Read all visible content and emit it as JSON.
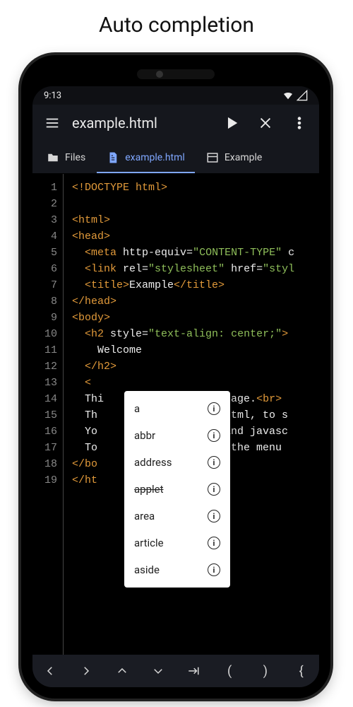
{
  "page_heading": "Auto completion",
  "status": {
    "time": "9:13"
  },
  "appbar": {
    "title": "example.html"
  },
  "tabs": [
    {
      "id": "files",
      "label": "Files",
      "active": false
    },
    {
      "id": "example",
      "label": "example.html",
      "active": true
    },
    {
      "id": "preview",
      "label": "Example",
      "active": false
    }
  ],
  "line_count": 19,
  "code_segments": [
    [
      {
        "c": "t-doctype",
        "t": "<!DOCTYPE html>"
      }
    ],
    [],
    [
      {
        "c": "t-tag",
        "t": "<html>"
      }
    ],
    [
      {
        "c": "t-tag",
        "t": "<head>"
      }
    ],
    [
      {
        "c": "",
        "t": "  "
      },
      {
        "c": "t-tag",
        "t": "<meta "
      },
      {
        "c": "t-attr",
        "t": "http-equiv="
      },
      {
        "c": "t-val",
        "t": "\"CONTENT-TYPE\""
      },
      {
        "c": "t-attr",
        "t": " c"
      }
    ],
    [
      {
        "c": "",
        "t": "  "
      },
      {
        "c": "t-tag",
        "t": "<link "
      },
      {
        "c": "t-attr",
        "t": "rel="
      },
      {
        "c": "t-val",
        "t": "\"stylesheet\""
      },
      {
        "c": "t-attr",
        "t": " href="
      },
      {
        "c": "t-val",
        "t": "\"styl"
      }
    ],
    [
      {
        "c": "",
        "t": "  "
      },
      {
        "c": "t-tag",
        "t": "<title>"
      },
      {
        "c": "t-text",
        "t": "Example"
      },
      {
        "c": "t-tag",
        "t": "</title>"
      }
    ],
    [
      {
        "c": "t-tag",
        "t": "</head>"
      }
    ],
    [
      {
        "c": "t-tag",
        "t": "<body>"
      }
    ],
    [
      {
        "c": "",
        "t": "  "
      },
      {
        "c": "t-tag",
        "t": "<h2 "
      },
      {
        "c": "t-attr",
        "t": "style="
      },
      {
        "c": "t-val",
        "t": "\"text-align: center;\""
      },
      {
        "c": "t-tag",
        "t": ">"
      }
    ],
    [
      {
        "c": "",
        "t": "    "
      },
      {
        "c": "t-text",
        "t": "Welcome"
      }
    ],
    [
      {
        "c": "",
        "t": "  "
      },
      {
        "c": "t-tag",
        "t": "</h2>"
      }
    ],
    [
      {
        "c": "",
        "t": "  "
      },
      {
        "c": "t-lt",
        "t": "<"
      }
    ],
    [
      {
        "c": "",
        "t": "  "
      },
      {
        "c": "t-text",
        "t": "Thi             e web page."
      },
      {
        "c": "t-tag",
        "t": "<br>"
      }
    ],
    [
      {
        "c": "",
        "t": "  "
      },
      {
        "c": "t-text",
        "t": "Th              en in html, to s"
      }
    ],
    [
      {
        "c": "",
        "t": "  "
      },
      {
        "c": "t-text",
        "t": "Yo              , css and javasc"
      }
    ],
    [
      {
        "c": "",
        "t": "  "
      },
      {
        "c": "t-text",
        "t": "To              es use the menu "
      }
    ],
    [
      {
        "c": "t-tag",
        "t": "</bo"
      }
    ],
    [
      {
        "c": "t-tag",
        "t": "</ht"
      }
    ]
  ],
  "autocomplete": [
    {
      "label": "a",
      "deprecated": false
    },
    {
      "label": "abbr",
      "deprecated": false
    },
    {
      "label": "address",
      "deprecated": false
    },
    {
      "label": "applet",
      "deprecated": true
    },
    {
      "label": "area",
      "deprecated": false
    },
    {
      "label": "article",
      "deprecated": false
    },
    {
      "label": "aside",
      "deprecated": false
    }
  ],
  "bottomkeys": [
    "<",
    ">",
    "^",
    "v",
    "->|",
    "(",
    ")",
    "{"
  ]
}
